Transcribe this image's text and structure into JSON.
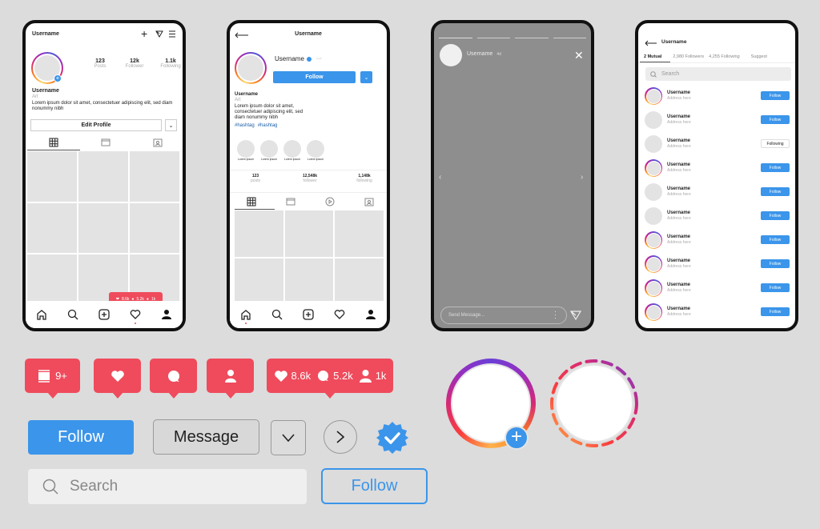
{
  "phone1": {
    "header_username": "Username",
    "stats": [
      {
        "value": "123",
        "label": "Posts"
      },
      {
        "value": "12k",
        "label": "Follower"
      },
      {
        "value": "1.1k",
        "label": "Following"
      }
    ],
    "name": "Username",
    "category": "Art",
    "bio": "Lorem ipsum dolor sit amet, consectetuer adipiscing elit, sed diam nonummy nibh",
    "edit_profile_label": "Edit Profile",
    "notif": {
      "likes": "8.6k",
      "comments": "5.2k",
      "followers": "1k"
    }
  },
  "phone2": {
    "header_title": "Username",
    "username": "Username",
    "follow_label": "Follow",
    "name": "Username",
    "category": "Art",
    "bio": "Lorem ipsum dolor sit amet, consectetuer adipiscing elit, sed diam nonummy nibh",
    "hashtags": [
      "#hashtag",
      "#hashtag"
    ],
    "highlights": [
      "Lorem ipsum",
      "Lorem ipsum",
      "Lorem ipsum",
      "Lorem ipsum"
    ],
    "stats": [
      {
        "value": "123",
        "label": "posts"
      },
      {
        "value": "12,548k",
        "label": "follower"
      },
      {
        "value": "1,148k",
        "label": "following"
      }
    ]
  },
  "phone3": {
    "username": "Username",
    "time": "4d",
    "message_placeholder": "Send Message..."
  },
  "phone4": {
    "header_title": "Username",
    "tabs": [
      "2 Mutual",
      "2,980 Followers",
      "4,255 Following",
      "Suggest"
    ],
    "search_placeholder": "Search",
    "users": [
      {
        "name": "Username",
        "address": "Address here",
        "action": "Follow",
        "story": true
      },
      {
        "name": "Username",
        "address": "Address here",
        "action": "Follow",
        "story": false
      },
      {
        "name": "Username",
        "address": "Address here",
        "action": "Following",
        "story": false
      },
      {
        "name": "Username",
        "address": "Address here",
        "action": "Follow",
        "story": true
      },
      {
        "name": "Username",
        "address": "Address here",
        "action": "Follow",
        "story": false
      },
      {
        "name": "Username",
        "address": "Address here",
        "action": "Follow",
        "story": false
      },
      {
        "name": "Username",
        "address": "Address here",
        "action": "Follow",
        "story": true
      },
      {
        "name": "Username",
        "address": "Address here",
        "action": "Follow",
        "story": true
      },
      {
        "name": "Username",
        "address": "Address here",
        "action": "Follow",
        "story": true
      },
      {
        "name": "Username",
        "address": "Address here",
        "action": "Follow",
        "story": true
      }
    ]
  },
  "kit": {
    "posts_badge": "9+",
    "combo_badge": {
      "likes": "8.6k",
      "comments": "5.2k",
      "followers": "1k"
    },
    "follow_label": "Follow",
    "message_label": "Message",
    "search_placeholder": "Search",
    "follow_outline_label": "Follow"
  },
  "colors": {
    "accent": "#3b95ea",
    "notify": "#ef4b5c",
    "frame": "#111111"
  }
}
